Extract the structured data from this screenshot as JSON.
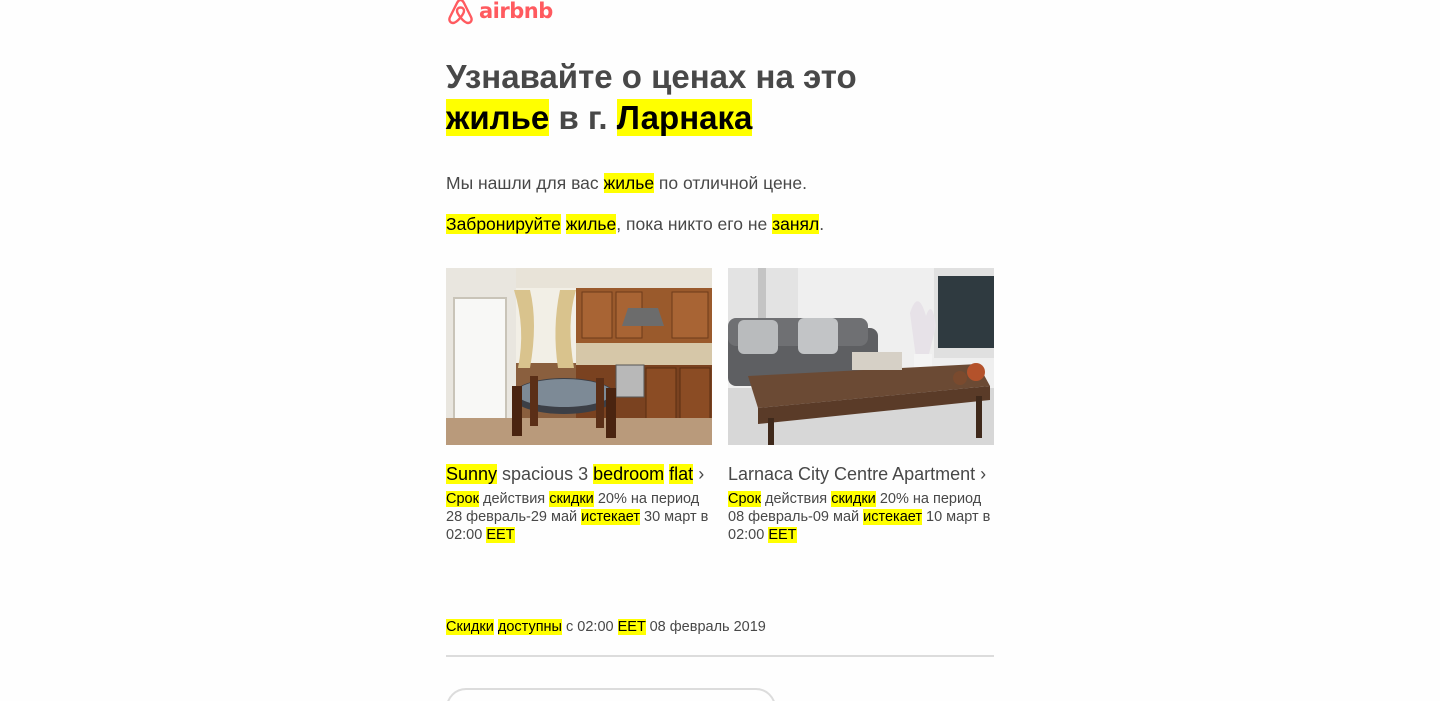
{
  "brand": {
    "name": "airbnb",
    "color": "#ff5a5f",
    "icon": "airbnb-belo-icon"
  },
  "headline": {
    "line1": "Узнавайте о ценах на это",
    "word_home": "жилье",
    "middle": " в г. ",
    "city": "Ларнака"
  },
  "intro": {
    "p1_before": "Мы нашли для вас ",
    "p1_hl": "жилье",
    "p1_after": " по отличной цене.",
    "p2_hl1": "Забронируйте",
    "p2_hl2": "жилье",
    "p2_mid": ", пока никто его не ",
    "p2_hl3": "занял",
    "p2_end": "."
  },
  "listings": [
    {
      "image_icon": "kitchen-photo",
      "title_parts": [
        "Sunny",
        " spacious 3 ",
        "bedroom",
        " ",
        "flat",
        " ›"
      ],
      "desc": {
        "w1": "Срок",
        "t1": " действия ",
        "w2": "скидки",
        "t2": " 20% на период 28 февраль-29 май ",
        "w3": "истекает",
        "t3": " 30 март в 02:00 ",
        "w4": "EET"
      }
    },
    {
      "image_icon": "living-room-photo",
      "title": "Larnaca City Centre Apartment ›",
      "desc": {
        "w1": "Срок",
        "t1": " действия ",
        "w2": "скидки",
        "t2": " 20% на период 08 февраль-09 май ",
        "w3": "истекает",
        "t3": " 10 март в 02:00 ",
        "w4": "EET"
      }
    }
  ],
  "availability": {
    "w1": "Скидки",
    "w2": "доступны",
    "t1": " с 02:00 ",
    "w3": "EET",
    "t2": " 08 февраль 2019"
  },
  "colors": {
    "highlight": "#ffff00",
    "text": "#484848",
    "divider": "#dcdcdc"
  }
}
